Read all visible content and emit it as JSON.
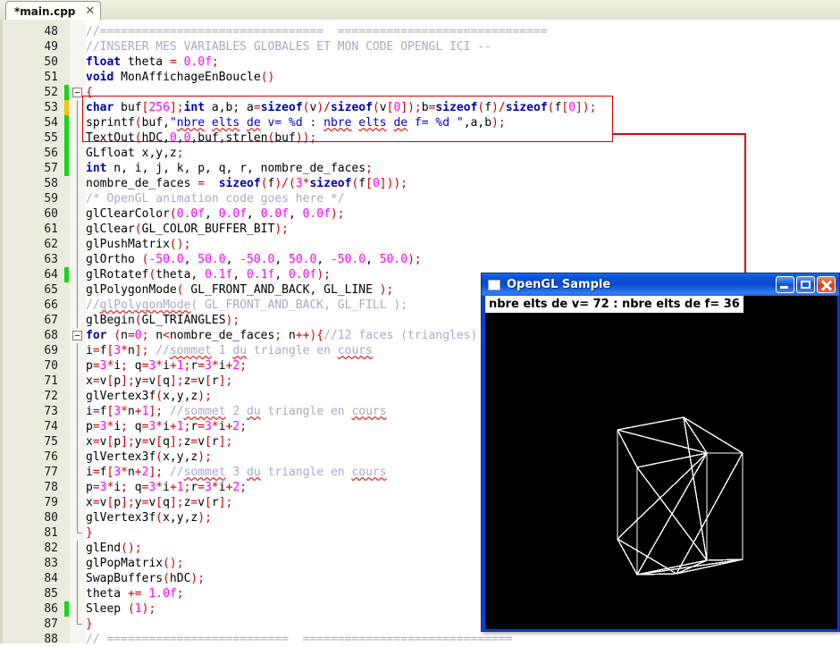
{
  "tab": {
    "label": "*main.cpp",
    "close_icon": "close-icon",
    "close_glyph": "✕"
  },
  "editor": {
    "first_line": 48,
    "last_line": 88,
    "lines": [
      {
        "n": 48,
        "mark": "",
        "fold": "",
        "html": "<span class='cm'>//================================  ==============================</span>"
      },
      {
        "n": 49,
        "mark": "",
        "fold": "",
        "html": "<span class='cm'>//INSERER MES VARIABLES GLOBALES ET MON CODE OPENGL ICI --</span>"
      },
      {
        "n": 50,
        "mark": "",
        "fold": "",
        "html": "<span class='kw'>float</span> theta <span class='pun'>=</span> <span class='num'>0.0f</span><span class='pun'>;</span>"
      },
      {
        "n": 51,
        "mark": "",
        "fold": "",
        "html": "<span class='kw'>void</span> MonAffichageEnBoucle<span class='pun'>()</span>"
      },
      {
        "n": 52,
        "mark": "green",
        "fold": "box",
        "html": "<span class='pun'>{</span>"
      },
      {
        "n": 53,
        "mark": "yellow",
        "fold": "line",
        "html": "<span class='kw'>char</span> buf<span class='pun'>[</span><span class='num'>256</span><span class='pun'>];</span><span class='kw'>int</span> a,b; a<span class='pun'>=</span><span class='kw'>sizeof</span><span class='pun'>(</span>v<span class='pun'>)/</span><span class='kw'>sizeof</span><span class='pun'>(</span>v<span class='pun'>[</span><span class='num'>0</span><span class='pun'>]);</span>b<span class='pun'>=</span><span class='kw'>sizeof</span><span class='pun'>(</span>f<span class='pun'>)/</span><span class='kw'>sizeof</span><span class='pun'>(</span>f<span class='pun'>[</span><span class='num'>0</span><span class='pun'>]);</span>"
      },
      {
        "n": 54,
        "mark": "green",
        "fold": "line",
        "html": "sprintf<span class='pun'>(</span>buf,<span class='str'>\"<span class='sp'>nbre</span> <span class='sp'>elts</span> <span class='sp'>de</span> v= %d : <span class='sp'>nbre</span> <span class='sp'>elts</span> <span class='sp'>de</span> f= %d \"</span>,a,b<span class='pun'>);</span>"
      },
      {
        "n": 55,
        "mark": "green",
        "fold": "line",
        "html": "TextOut<span class='pun'>(</span>hDC,<span class='num'>0</span>,<span class='num'>0</span>,buf,strlen<span class='pun'>(</span>buf<span class='pun'>));</span>"
      },
      {
        "n": 56,
        "mark": "green",
        "fold": "line",
        "html": "GLfloat x,y,z<span class='pun'>;</span>"
      },
      {
        "n": 57,
        "mark": "green",
        "fold": "line",
        "html": "<span class='kw'>int</span> n, i, j, k, p, q, r, nombre_de_faces<span class='pun'>;</span>"
      },
      {
        "n": 58,
        "mark": "",
        "fold": "line",
        "html": "nombre_de_faces <span class='pun'>=</span>  <span class='kw'>sizeof</span><span class='pun'>(</span>f<span class='pun'>)/(</span><span class='num'>3</span><span class='pun'>*</span><span class='kw'>sizeof</span><span class='pun'>(</span>f<span class='pun'>[</span><span class='num'>0</span><span class='pun'>]));</span>"
      },
      {
        "n": 59,
        "mark": "",
        "fold": "line",
        "html": "<span class='cm'>/* OpenGL animation code goes here */</span>"
      },
      {
        "n": 60,
        "mark": "",
        "fold": "line",
        "html": "glClearColor<span class='pun'>(</span><span class='num'>0.0f</span>, <span class='num'>0.0f</span>, <span class='num'>0.0f</span>, <span class='num'>0.0f</span><span class='pun'>);</span>"
      },
      {
        "n": 61,
        "mark": "",
        "fold": "line",
        "html": "glClear<span class='pun'>(</span>GL_COLOR_BUFFER_BIT<span class='pun'>);</span>"
      },
      {
        "n": 62,
        "mark": "",
        "fold": "line",
        "html": "glPushMatrix<span class='pun'>();</span>"
      },
      {
        "n": 63,
        "mark": "",
        "fold": "line",
        "html": "glOrtho <span class='pun'>(</span><span class='num'>-50.0</span>, <span class='num'>50.0</span>, <span class='num'>-50.0</span>, <span class='num'>50.0</span>, <span class='num'>-50.0</span>, <span class='num'>50.0</span><span class='pun'>);</span>"
      },
      {
        "n": 64,
        "mark": "green",
        "fold": "line",
        "html": "glRotatef<span class='pun'>(</span>theta, <span class='num'>0.1f</span>, <span class='num'>0.1f</span>, <span class='num'>0.0f</span><span class='pun'>);</span>"
      },
      {
        "n": 65,
        "mark": "",
        "fold": "line",
        "html": "glPolygonMode<span class='pun'>(</span> GL_FRONT_AND_BACK, GL_LINE <span class='pun'>);</span>"
      },
      {
        "n": 66,
        "mark": "",
        "fold": "line",
        "html": "<span class='cm'>//<span class='sp'>glPolygonMode</span>( GL_FRONT_AND_BACK, GL_FILL );</span>"
      },
      {
        "n": 67,
        "mark": "",
        "fold": "line",
        "html": "glBegin<span class='pun'>(</span>GL_TRIANGLES<span class='pun'>);</span>"
      },
      {
        "n": 68,
        "mark": "",
        "fold": "box",
        "html": "<span class='kw'>for</span> <span class='pun'>(</span>n<span class='pun'>=</span><span class='num'>0</span><span class='pun'>;</span> n<span class='pun'>&lt;</span>nombre_de_faces<span class='pun'>;</span> n<span class='pun'>++){</span><span class='cm'>//12 faces (triangles)</span>"
      },
      {
        "n": 69,
        "mark": "",
        "fold": "line2",
        "html": "i<span class='pun'>=</span>f<span class='pun'>[</span><span class='num'>3</span><span class='pun'>*</span>n<span class='pun'>];</span> <span class='cm'>//<span class='sp'>sommet</span> 1 <span class='sp'>du</span> triangle en <span class='sp'>cours</span></span>"
      },
      {
        "n": 70,
        "mark": "",
        "fold": "line2",
        "html": "p<span class='pun'>=</span><span class='num'>3</span><span class='pun'>*</span>i<span class='pun'>;</span> q<span class='pun'>=</span><span class='num'>3</span><span class='pun'>*</span>i<span class='pun'>+</span><span class='num'>1</span><span class='pun'>;</span>r<span class='pun'>=</span><span class='num'>3</span><span class='pun'>*</span>i<span class='pun'>+</span><span class='num'>2</span><span class='pun'>;</span>"
      },
      {
        "n": 71,
        "mark": "",
        "fold": "line2",
        "html": "x<span class='pun'>=</span>v<span class='pun'>[</span>p<span class='pun'>];</span>y<span class='pun'>=</span>v<span class='pun'>[</span>q<span class='pun'>];</span>z<span class='pun'>=</span>v<span class='pun'>[</span>r<span class='pun'>];</span>"
      },
      {
        "n": 72,
        "mark": "",
        "fold": "line2",
        "html": "glVertex3f<span class='pun'>(</span>x,y,z<span class='pun'>);</span>"
      },
      {
        "n": 73,
        "mark": "",
        "fold": "line2",
        "html": "i<span class='pun'>=</span>f<span class='pun'>[</span><span class='num'>3</span><span class='pun'>*</span>n<span class='pun'>+</span><span class='num'>1</span><span class='pun'>];</span> <span class='cm'>//<span class='sp'>sommet</span> 2 <span class='sp'>du</span> triangle en <span class='sp'>cours</span></span>"
      },
      {
        "n": 74,
        "mark": "",
        "fold": "line2",
        "html": "p<span class='pun'>=</span><span class='num'>3</span><span class='pun'>*</span>i<span class='pun'>;</span> q<span class='pun'>=</span><span class='num'>3</span><span class='pun'>*</span>i<span class='pun'>+</span><span class='num'>1</span><span class='pun'>;</span>r<span class='pun'>=</span><span class='num'>3</span><span class='pun'>*</span>i<span class='pun'>+</span><span class='num'>2</span><span class='pun'>;</span>"
      },
      {
        "n": 75,
        "mark": "",
        "fold": "line2",
        "html": "x<span class='pun'>=</span>v<span class='pun'>[</span>p<span class='pun'>];</span>y<span class='pun'>=</span>v<span class='pun'>[</span>q<span class='pun'>];</span>z<span class='pun'>=</span>v<span class='pun'>[</span>r<span class='pun'>];</span>"
      },
      {
        "n": 76,
        "mark": "",
        "fold": "line2",
        "html": "glVertex3f<span class='pun'>(</span>x,y,z<span class='pun'>);</span>"
      },
      {
        "n": 77,
        "mark": "",
        "fold": "line2",
        "html": "i<span class='pun'>=</span>f<span class='pun'>[</span><span class='num'>3</span><span class='pun'>*</span>n<span class='pun'>+</span><span class='num'>2</span><span class='pun'>];</span> <span class='cm'>//<span class='sp'>sommet</span> 3 <span class='sp'>du</span> triangle en <span class='sp'>cours</span></span>"
      },
      {
        "n": 78,
        "mark": "",
        "fold": "line2",
        "html": "p<span class='pun'>=</span><span class='num'>3</span><span class='pun'>*</span>i<span class='pun'>;</span> q<span class='pun'>=</span><span class='num'>3</span><span class='pun'>*</span>i<span class='pun'>+</span><span class='num'>1</span><span class='pun'>;</span>r<span class='pun'>=</span><span class='num'>3</span><span class='pun'>*</span>i<span class='pun'>+</span><span class='num'>2</span><span class='pun'>;</span>"
      },
      {
        "n": 79,
        "mark": "",
        "fold": "line2",
        "html": "x<span class='pun'>=</span>v<span class='pun'>[</span>p<span class='pun'>];</span>y<span class='pun'>=</span>v<span class='pun'>[</span>q<span class='pun'>];</span>z<span class='pun'>=</span>v<span class='pun'>[</span>r<span class='pun'>];</span>"
      },
      {
        "n": 80,
        "mark": "",
        "fold": "line2",
        "html": "glVertex3f<span class='pun'>(</span>x,y,z<span class='pun'>);</span>"
      },
      {
        "n": 81,
        "mark": "",
        "fold": "end2",
        "html": "<span class='pun'>}</span>"
      },
      {
        "n": 82,
        "mark": "",
        "fold": "line",
        "html": "glEnd<span class='pun'>();</span>"
      },
      {
        "n": 83,
        "mark": "",
        "fold": "line",
        "html": "glPopMatrix<span class='pun'>();</span>"
      },
      {
        "n": 84,
        "mark": "",
        "fold": "line",
        "html": "SwapBuffers<span class='pun'>(</span>hDC<span class='pun'>);</span>"
      },
      {
        "n": 85,
        "mark": "",
        "fold": "line",
        "html": "theta <span class='pun'>+=</span> <span class='num'>1.0f</span><span class='pun'>;</span>"
      },
      {
        "n": 86,
        "mark": "green",
        "fold": "line",
        "html": "Sleep <span class='pun'>(</span><span class='num'>1</span><span class='pun'>);</span>"
      },
      {
        "n": 87,
        "mark": "",
        "fold": "end",
        "html": "<span class='pun'>}</span>"
      },
      {
        "n": 88,
        "mark": "",
        "fold": "",
        "html": "<span class='cm'>// ==========================  ==============================</span>"
      }
    ],
    "highlight_box": {
      "label": "added-code-highlight",
      "color": "#d40000"
    },
    "annotation": {
      "label": "callout-arrow",
      "color": "#e00000"
    }
  },
  "opengl_window": {
    "title": "OpenGL Sample",
    "app_icon": "window-icon",
    "minimize_label": "Minimize",
    "maximize_label": "Maximize",
    "close_label": "Close",
    "output_text": "nbre elts de v= 72 : nbre elts de f= 36",
    "vertex_count": 72,
    "face_count": 36,
    "render": {
      "name": "wireframe-cube",
      "background": "#000000",
      "line_color": "#ffffff",
      "polygon_mode": "GL_LINE"
    }
  }
}
